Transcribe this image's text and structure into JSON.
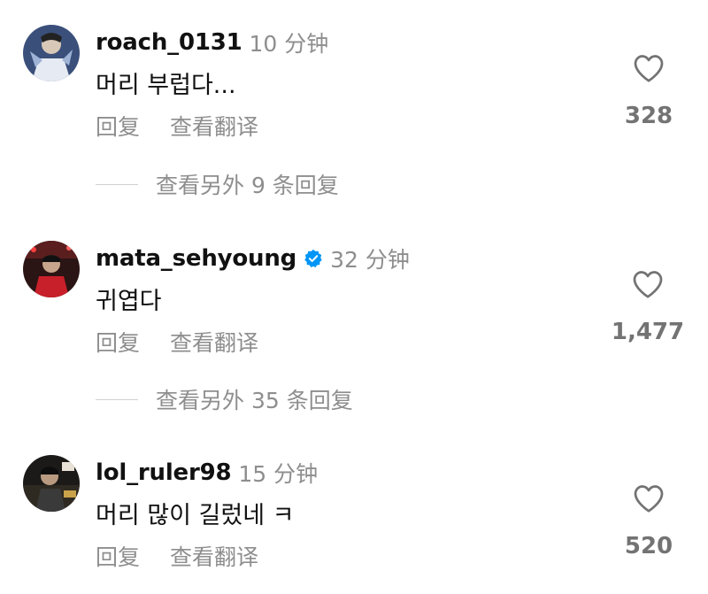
{
  "comments": [
    {
      "username": "roach_0131",
      "time": "10 分钟",
      "text": "머리 부럽다...",
      "reply_label": "回复",
      "translate_label": "查看翻译",
      "likes": "328",
      "verified": false,
      "more_replies": "查看另外 9 条回复"
    },
    {
      "username": "mata_sehyoung",
      "time": "32 分钟",
      "text": "귀엽다",
      "reply_label": "回复",
      "translate_label": "查看翻译",
      "likes": "1,477",
      "verified": true,
      "more_replies": "查看另外 35 条回复"
    },
    {
      "username": "lol_ruler98",
      "time": "15 分钟",
      "text": "머리 많이 길렀네 ㅋ",
      "reply_label": "回复",
      "translate_label": "查看翻译",
      "likes": "520",
      "verified": false
    }
  ],
  "colors": {
    "text_primary": "#111111",
    "text_secondary": "#8e8e8e",
    "verified_blue": "#0095f6"
  }
}
